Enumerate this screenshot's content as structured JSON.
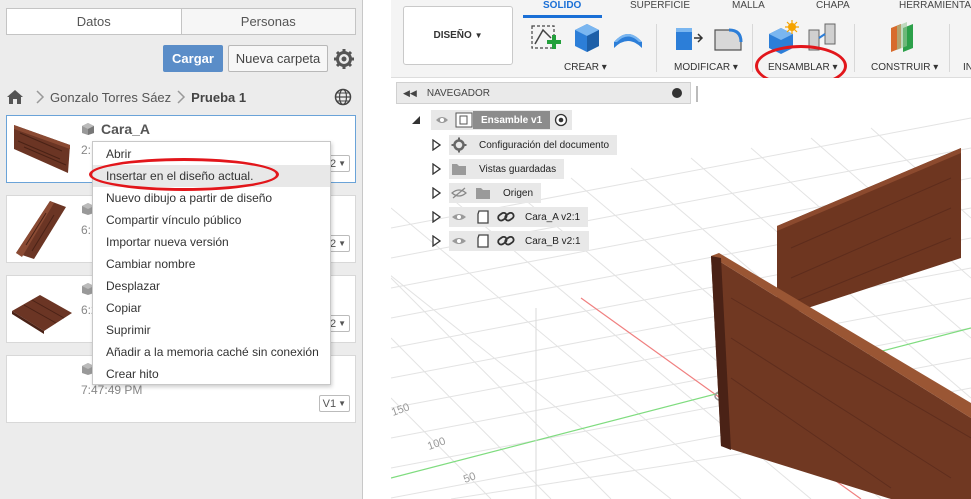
{
  "left_panel": {
    "tabs": [
      {
        "label": "Datos",
        "active": true
      },
      {
        "label": "Personas",
        "active": false
      }
    ],
    "upload_label": "Cargar",
    "new_folder_label": "Nueva carpeta",
    "breadcrumb": {
      "project": "Gonzalo Torres Sáez",
      "folder": "Prueba 1"
    },
    "files": [
      {
        "name": "Cara_A",
        "time": "2:",
        "version": "V2",
        "selected": true
      },
      {
        "name": "",
        "time": "6:",
        "version": "V2",
        "selected": false
      },
      {
        "name": "",
        "time": "6:2",
        "version": "V2",
        "selected": false
      },
      {
        "name": "",
        "time": "7:47:49 PM",
        "version": "V1",
        "selected": false
      }
    ],
    "context_menu": [
      "Abrir",
      "Insertar en el diseño actual.",
      "Nuevo dibujo a partir de diseño",
      "Compartir vínculo público",
      "Importar nueva versión",
      "Cambiar nombre",
      "Desplazar",
      "Copiar",
      "Suprimir",
      "Añadir a la memoria caché sin conexión",
      "Crear hito"
    ]
  },
  "toolbar": {
    "workspace_label": "DISEÑO",
    "tabs": [
      "SÓLIDO",
      "SUPERFICIE",
      "MALLA",
      "CHAPA",
      "HERRAMIENTA"
    ],
    "active_tab": "SÓLIDO",
    "groups": [
      "CREAR",
      "MODIFICAR",
      "ENSAMBLAR",
      "CONSTRUIR",
      "IN"
    ],
    "accent_color": "#1a6fd6",
    "highlight_color": "#e2161b"
  },
  "navigator": {
    "title": "NAVEGADOR",
    "root": "Ensamble v1",
    "items": [
      {
        "label": "Configuración del documento",
        "icon": "gear-icon"
      },
      {
        "label": "Vistas guardadas",
        "icon": "folder-icon"
      },
      {
        "label": "Origen",
        "icon": "folder-icon"
      },
      {
        "label": "Cara_A v2:1",
        "icon": "component-icon"
      },
      {
        "label": "Cara_B v2:1",
        "icon": "component-icon"
      }
    ]
  },
  "viewport": {
    "axis_labels": [
      "150",
      "100",
      "50"
    ]
  }
}
